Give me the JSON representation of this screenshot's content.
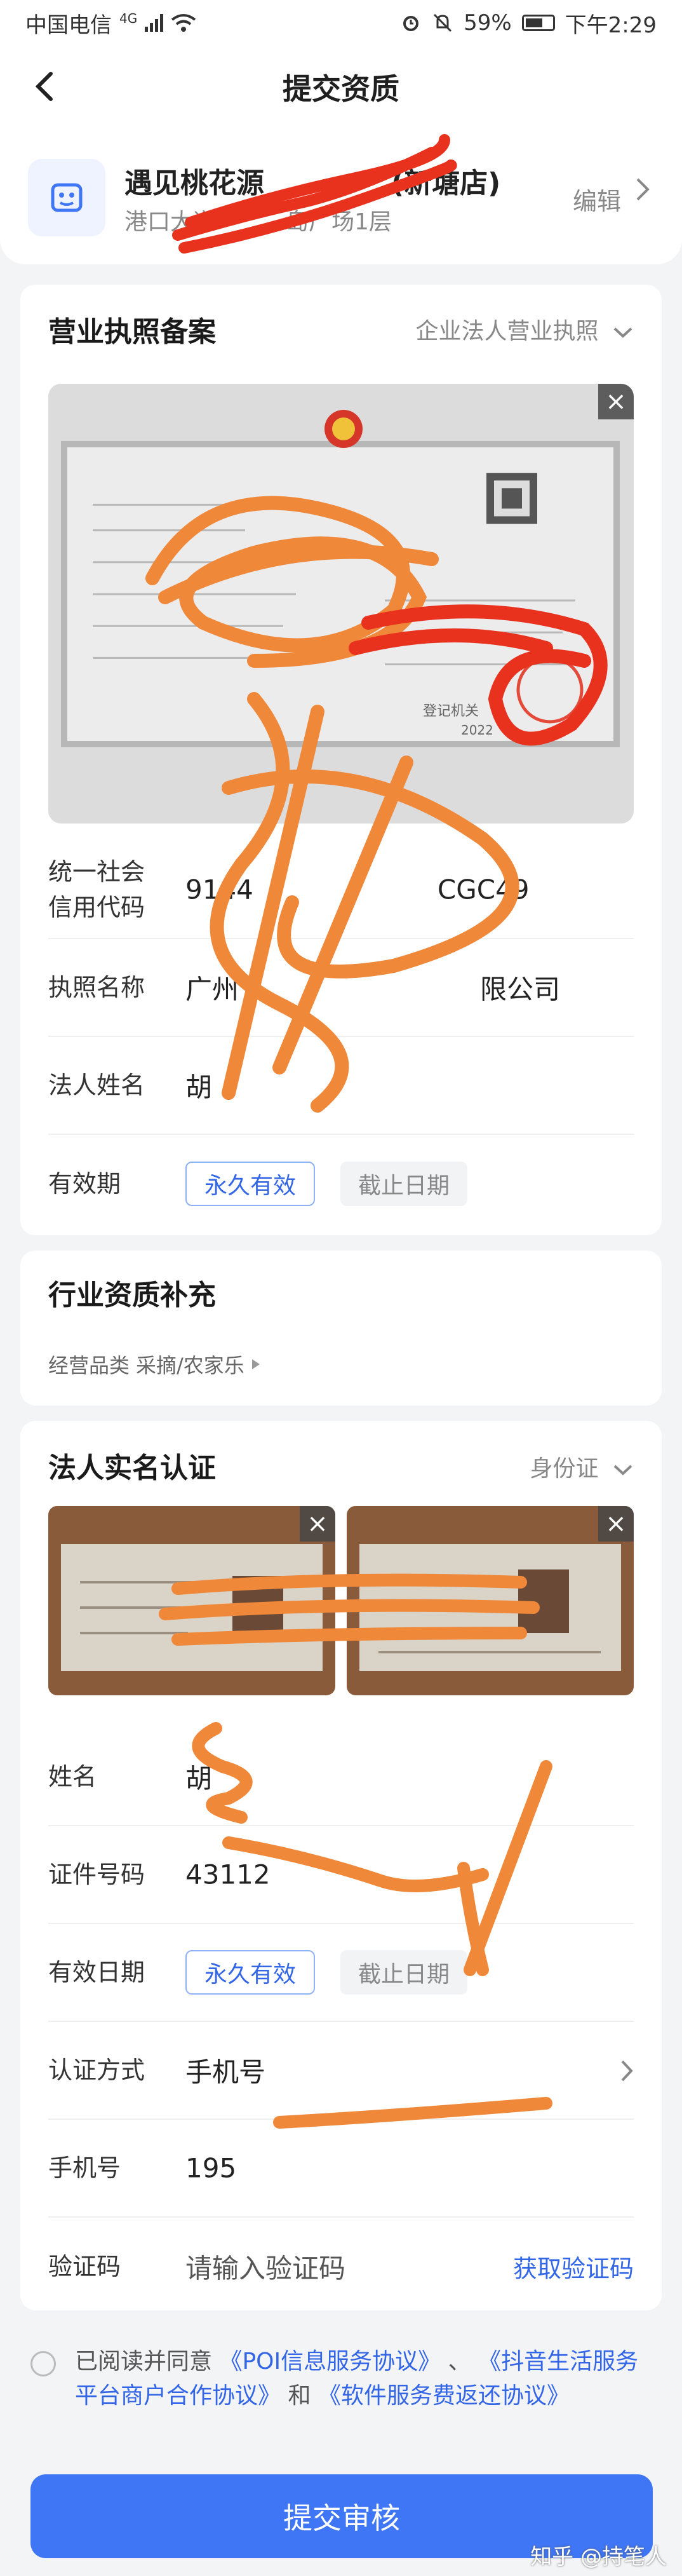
{
  "status_bar": {
    "carrier": "中国电信",
    "network": "4G",
    "battery": "59%",
    "time": "下午2:29"
  },
  "nav": {
    "title": "提交资质"
  },
  "store": {
    "name": "遇见桃花源",
    "name_suffix": "(新塘店)",
    "address": "港口大道",
    "address_suffix": "岛广场1层",
    "edit_label": "编辑"
  },
  "license": {
    "title": "营业执照备案",
    "type_label": "企业法人营业执照",
    "fields": [
      {
        "label": "统一社会\n信用代码",
        "value": "9144"
      },
      {
        "label": "执照名称",
        "value": "广州"
      },
      {
        "label": "法人姓名",
        "value": "胡"
      }
    ],
    "validity_label": "有效期",
    "validity_permanent": "永久有效",
    "validity_deadline": "截止日期",
    "credit_code_tail": "CGC49",
    "company_tail": "限公司",
    "cert_stamp_text": "登记机关",
    "cert_year": "2022"
  },
  "industry": {
    "title": "行业资质补充",
    "category_label": "经营品类",
    "category_value": "采摘/农家乐"
  },
  "legal_person": {
    "title": "法人实名认证",
    "id_type": "身份证",
    "name_label": "姓名",
    "name_value": "胡",
    "id_number_label": "证件号码",
    "id_number_value": "43112",
    "validity_label": "有效日期",
    "validity_permanent": "永久有效",
    "validity_deadline": "截止日期",
    "auth_method_label": "认证方式",
    "auth_method_value": "手机号",
    "phone_label": "手机号",
    "phone_value": "195",
    "code_label": "验证码",
    "code_placeholder": "请输入验证码",
    "get_code": "获取验证码"
  },
  "agreement": {
    "prefix": "已阅读并同意",
    "poi": "《POI信息服务协议》",
    "sep": "、",
    "merchant": "《抖音生活服务平台商户合作协议》",
    "and": "和",
    "refund": "《软件服务费返还协议》"
  },
  "submit_label": "提交审核",
  "watermark": "知乎 @持笔人",
  "colors": {
    "accent": "#3f76f6",
    "scribble_orange": "#f0883a",
    "scribble_red": "#e8321e"
  }
}
